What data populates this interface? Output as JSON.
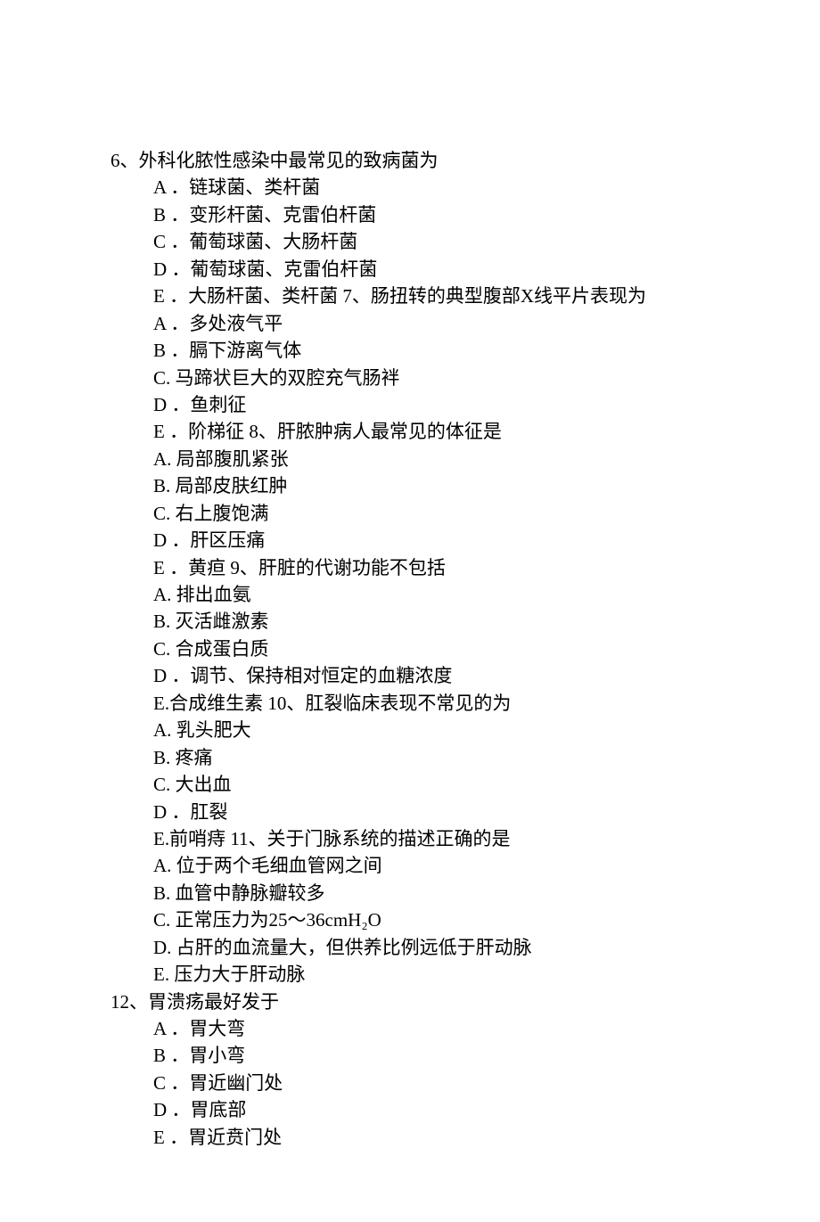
{
  "questions": [
    {
      "number": "6、",
      "text": "外科化脓性感染中最常见的致病菌为",
      "options": [
        {
          "letter": "A ．",
          "text": "链球菌、类杆菌"
        },
        {
          "letter": "B ．",
          "text": "变形杆菌、克雷伯杆菌"
        },
        {
          "letter": "C ．",
          "text": "葡萄球菌、大肠杆菌"
        },
        {
          "letter": "D ．",
          "text": "葡萄球菌、克雷伯杆菌"
        },
        {
          "letter": "E ．",
          "text": "大肠杆菌、类杆菌 7、肠扭转的典型腹部X线平片表现为"
        },
        {
          "letter": "A ．",
          "text": "多处液气平"
        },
        {
          "letter": "B ．",
          "text": "膈下游离气体"
        },
        {
          "letter": "C.  ",
          "text": "马蹄状巨大的双腔充气肠袢"
        },
        {
          "letter": "D ．",
          "text": "鱼刺征"
        },
        {
          "letter": "E ．",
          "text": "阶梯征 8、肝脓肿病人最常见的体征是"
        },
        {
          "letter": "A. ",
          "text": "局部腹肌紧张"
        },
        {
          "letter": "B. ",
          "text": "局部皮肤红肿"
        },
        {
          "letter": "C. ",
          "text": "右上腹饱满"
        },
        {
          "letter": "D ．",
          "text": "肝区压痛"
        },
        {
          "letter": "E ．",
          "text": "黄疸 9、肝脏的代谢功能不包括"
        },
        {
          "letter": "A. ",
          "text": "排出血氨"
        },
        {
          "letter": "B. ",
          "text": "灭活雌激素"
        },
        {
          "letter": "C. ",
          "text": "合成蛋白质"
        },
        {
          "letter": "D ．",
          "text": "调节、保持相对恒定的血糖浓度"
        },
        {
          "letter": "E.",
          "text": "合成维生素 10、肛裂临床表现不常见的为"
        },
        {
          "letter": "A. ",
          "text": "乳头肥大"
        },
        {
          "letter": "B. ",
          "text": "疼痛"
        },
        {
          "letter": "C. ",
          "text": "大出血"
        },
        {
          "letter": "D ．",
          "text": "肛裂"
        },
        {
          "letter": "E.",
          "text": "前哨痔 11、关于门脉系统的描述正确的是"
        },
        {
          "letter": "A. ",
          "text": "位于两个毛细血管网之间"
        },
        {
          "letter": "B. ",
          "text": "血管中静脉瓣较多"
        },
        {
          "letter": "C. ",
          "text": "正常压力为25～36cmH₂O"
        },
        {
          "letter": "D. ",
          "text": "占肝的血流量大，但供养比例远低于肝动脉"
        },
        {
          "letter": "E. ",
          "text": "压力大于肝动脉"
        }
      ]
    },
    {
      "number": "12、",
      "text": "胃溃疡最好发于",
      "options": [
        {
          "letter": "A ．",
          "text": "胃大弯"
        },
        {
          "letter": "B ．",
          "text": "胃小弯"
        },
        {
          "letter": "C ．",
          "text": "胃近幽门处"
        },
        {
          "letter": "D ．",
          "text": "胃底部"
        },
        {
          "letter": "E ．",
          "text": "胃近贲门处"
        }
      ]
    }
  ]
}
